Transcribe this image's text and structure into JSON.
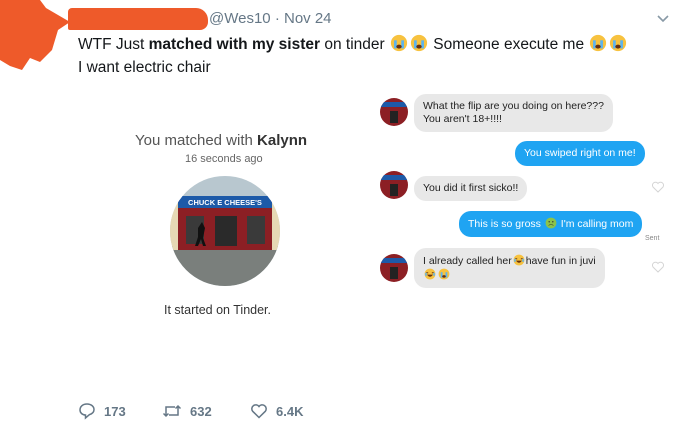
{
  "tweet": {
    "handle": "@Wes10",
    "separator": "·",
    "date": "Nov 24",
    "text_part1": "WTF Just ",
    "text_bold": "matched with my sister",
    "text_part2": " on tinder",
    "text_part3": " Someone execute me ",
    "text_line2": "I want electric chair"
  },
  "match_card": {
    "title_prefix": "You matched with ",
    "match_name": "Kalynn",
    "time": "16 seconds ago",
    "photo_sign": "CHUCK E CHEESE'S",
    "caption": "It started on Tinder."
  },
  "chat": {
    "msg1_line1": "What the flip are you doing on here???",
    "msg1_line2": "You aren't 18+!!!!",
    "msg2": "You swiped right on me!",
    "msg3": "You did it first sicko!!",
    "msg4_part1": "This is so gross ",
    "msg4_part2": " I'm calling mom",
    "sent_label": "Sent",
    "msg5_part1": "I already called her",
    "msg5_part2": "have fun in juvi"
  },
  "actions": {
    "replies": "173",
    "retweets": "632",
    "likes": "6.4K"
  },
  "colors": {
    "redaction": "#ee5a2a",
    "bubble_out": "#1fa4f2",
    "bubble_in": "#e8e8e8",
    "muted_text": "#657786"
  },
  "icons": [
    "chevron-down-icon",
    "crying-emoji-icon",
    "nauseated-emoji-icon",
    "laughing-emoji-icon",
    "heart-icon",
    "reply-icon",
    "retweet-icon",
    "like-icon"
  ]
}
